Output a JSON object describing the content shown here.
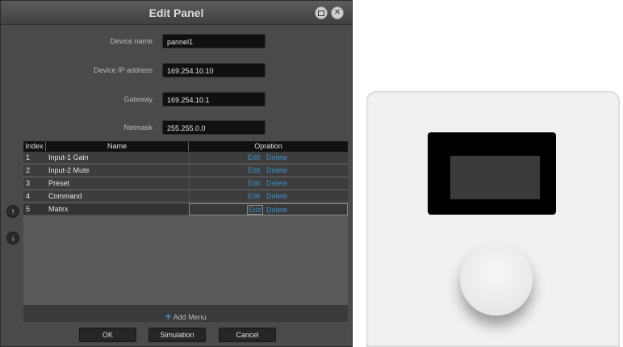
{
  "dialog": {
    "title": "Edit Panel",
    "fields": {
      "device_name": {
        "label": "Device name",
        "value": "pannel1"
      },
      "device_ip": {
        "label": "Device IP address",
        "value": "169.254.10.10"
      },
      "gateway": {
        "label": "Gateway",
        "value": "169.254.10.1"
      },
      "netmask": {
        "label": "Netmask",
        "value": "255.255.0.0"
      }
    },
    "table": {
      "columns": [
        "Index",
        "Name",
        "Opration"
      ],
      "rows": [
        {
          "index": "1",
          "name": "Input-1 Gain",
          "edit": "Edit",
          "delete": "Delete"
        },
        {
          "index": "2",
          "name": "Input-2 Mute",
          "edit": "Edit",
          "delete": "Delete"
        },
        {
          "index": "3",
          "name": "Preset",
          "edit": "Edit",
          "delete": "Delete"
        },
        {
          "index": "4",
          "name": "Command",
          "edit": "Edit",
          "delete": "Delete"
        },
        {
          "index": "5",
          "name": "Matirx",
          "edit": "Edit",
          "delete": "Delete"
        }
      ],
      "selected_row": 5,
      "add_menu_label": "Add Menu"
    },
    "buttons": {
      "ok": "OK",
      "simulation": "Simulation",
      "cancel": "Cancel"
    },
    "icons": {
      "move_up": "arrow-up-icon",
      "move_down": "arrow-down-icon",
      "add": "plus-icon"
    },
    "accent_color": "#3a8dc7"
  }
}
